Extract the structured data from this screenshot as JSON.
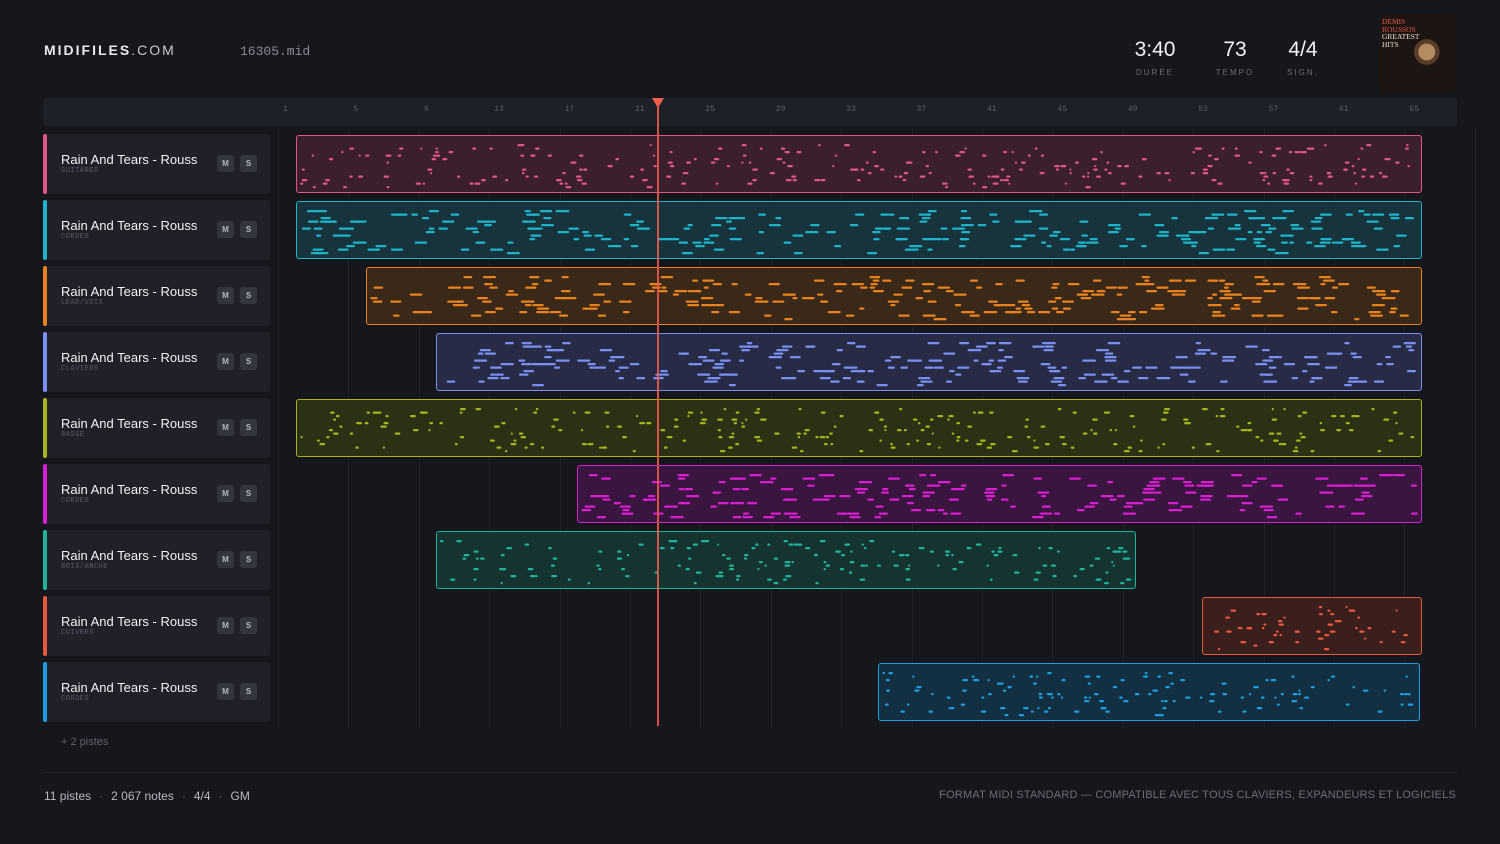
{
  "brand": {
    "name": "MIDIFILES",
    "domain": ".COM"
  },
  "file": {
    "name": "16305.mid"
  },
  "stats": [
    {
      "value": "3:40",
      "label": "DURÉE"
    },
    {
      "value": "73",
      "label": "TEMPO"
    },
    {
      "value": "4/4",
      "label": "SIGN."
    }
  ],
  "album": {
    "line1": "DEMIS",
    "line2": "ROUSSOS",
    "line3": "GREATEST",
    "line4": "HITS"
  },
  "ruler": {
    "ticks": [
      "1",
      "5",
      "9",
      "13",
      "17",
      "21",
      "25",
      "29",
      "33",
      "37",
      "41",
      "45",
      "49",
      "53",
      "57",
      "61",
      "65"
    ]
  },
  "playhead_bar": 22.2,
  "tracks": [
    {
      "name": "Rain And Tears - Rouss",
      "category": "GUITARES",
      "color": "#e0558a",
      "fill": "#3b1f2e",
      "start_bar": 1.6,
      "end_bar": 65.6,
      "mute": "M",
      "solo": "S"
    },
    {
      "name": "Rain And Tears - Rouss",
      "category": "CORDES",
      "color": "#1fb3c9",
      "fill": "#17333b",
      "start_bar": 1.6,
      "end_bar": 65.6,
      "mute": "M",
      "solo": "S"
    },
    {
      "name": "Rain And Tears - Rouss",
      "category": "LEAD/VOIX",
      "color": "#e8821f",
      "fill": "#3a2818",
      "start_bar": 5.6,
      "end_bar": 65.6,
      "mute": "M",
      "solo": "S"
    },
    {
      "name": "Rain And Tears - Rouss",
      "category": "CLAVIERS",
      "color": "#7b8ff0",
      "fill": "#272b46",
      "start_bar": 9.6,
      "end_bar": 65.6,
      "mute": "M",
      "solo": "S"
    },
    {
      "name": "Rain And Tears - Rouss",
      "category": "BASSE",
      "color": "#a4b51c",
      "fill": "#2c3115",
      "start_bar": 1.6,
      "end_bar": 65.6,
      "mute": "M",
      "solo": "S"
    },
    {
      "name": "Rain And Tears - Rouss",
      "category": "CORDES",
      "color": "#d61fd0",
      "fill": "#3a1540",
      "start_bar": 17.6,
      "end_bar": 65.6,
      "mute": "M",
      "solo": "S"
    },
    {
      "name": "Rain And Tears - Rouss",
      "category": "BOIS/ANCHE",
      "color": "#1fb39a",
      "fill": "#143331",
      "start_bar": 9.6,
      "end_bar": 49.4,
      "mute": "M",
      "solo": "S"
    },
    {
      "name": "Rain And Tears - Rouss",
      "category": "CUIVRES",
      "color": "#e8583f",
      "fill": "#3a1f1c",
      "start_bar": 53.1,
      "end_bar": 65.6,
      "mute": "M",
      "solo": "S"
    },
    {
      "name": "Rain And Tears - Rouss",
      "category": "CORDES",
      "color": "#1a9ee0",
      "fill": "#132f42",
      "start_bar": 34.7,
      "end_bar": 65.5,
      "mute": "M",
      "solo": "S"
    }
  ],
  "more_tracks": "+ 2 pistes",
  "footer": {
    "tracks": "11 pistes",
    "notes": "2 067 notes",
    "signature": "4/4",
    "standard": "GM",
    "format": "FORMAT MIDI STANDARD — COMPATIBLE AVEC TOUS CLAVIERS, EXPANDEURS ET LOGICIELS"
  }
}
